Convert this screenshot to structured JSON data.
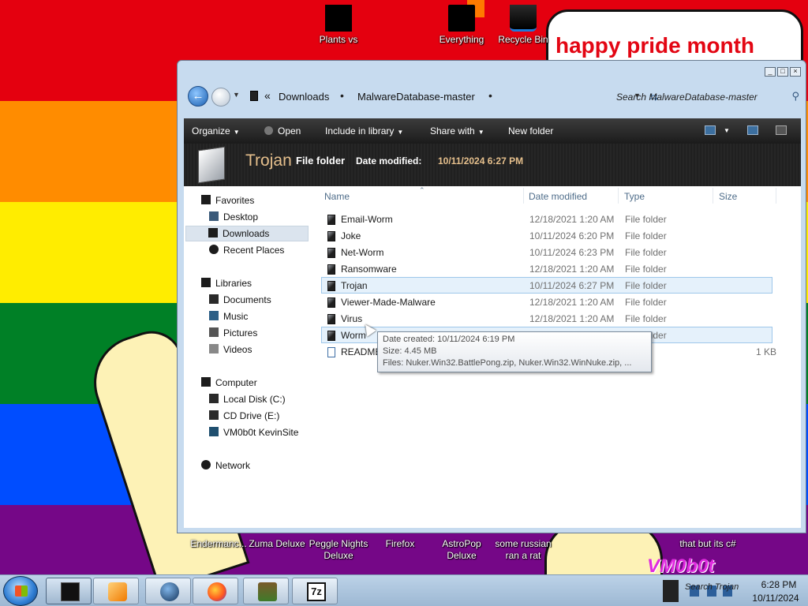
{
  "desktop": {
    "banner": "happy pride month",
    "icons_top": [
      {
        "label": "Plants vs",
        "icon": "plants-vs-zombies-icon"
      },
      {
        "label": "Everything",
        "icon": "everything-search-icon"
      },
      {
        "label": "Recycle Bin",
        "icon": "recycle-bin-icon"
      }
    ],
    "icons_bottom": [
      {
        "label": "Endermanc...",
        "icon": "app-icon"
      },
      {
        "label": "Zuma Deluxe",
        "icon": "game-icon"
      },
      {
        "label": "Peggle Nights Deluxe",
        "icon": "game-icon"
      },
      {
        "label": "Firefox",
        "icon": "firefox-icon"
      },
      {
        "label": "AstroPop Deluxe",
        "icon": "game-icon"
      },
      {
        "label": "some russian ran a rat",
        "icon": "file-icon"
      },
      {
        "label": "that but its c#",
        "icon": "file-icon"
      }
    ],
    "logo_text": "VM0b0t",
    "stripe_colors": [
      "#e4000f",
      "#ff8c00",
      "#ffed00",
      "#008026",
      "#004dff",
      "#750787"
    ]
  },
  "window": {
    "breadcrumb": [
      "Downloads",
      "MalwareDatabase-master"
    ],
    "breadcrumb_prefix": "«",
    "search_placeholder": "Search MalwareDatabase-master",
    "toolbar": {
      "organize": "Organize",
      "open": "Open",
      "include": "Include in library",
      "share": "Share with",
      "new_folder": "New folder"
    },
    "details": {
      "name": "Trojan",
      "type": "File folder",
      "modified_label": "Date modified:",
      "modified_value": "10/11/2024 6:27 PM"
    },
    "nav": {
      "favorites": "Favorites",
      "desktop": "Desktop",
      "downloads": "Downloads",
      "recent": "Recent Places",
      "libraries": "Libraries",
      "documents": "Documents",
      "music": "Music",
      "pictures": "Pictures",
      "videos": "Videos",
      "computer": "Computer",
      "local_disk": "Local Disk (C:)",
      "cd_drive": "CD Drive (E:)",
      "vm": "VM0b0t KevinSite",
      "network": "Network"
    },
    "columns": {
      "name": "Name",
      "date": "Date modified",
      "type": "Type",
      "size": "Size"
    },
    "rows": [
      {
        "name": "Email-Worm",
        "date": "12/18/2021 1:20 AM",
        "type": "File folder",
        "size": ""
      },
      {
        "name": "Joke",
        "date": "10/11/2024 6:20 PM",
        "type": "File folder",
        "size": ""
      },
      {
        "name": "Net-Worm",
        "date": "10/11/2024 6:23 PM",
        "type": "File folder",
        "size": ""
      },
      {
        "name": "Ransomware",
        "date": "12/18/2021 1:20 AM",
        "type": "File folder",
        "size": ""
      },
      {
        "name": "Trojan",
        "date": "10/11/2024 6:27 PM",
        "type": "File folder",
        "size": ""
      },
      {
        "name": "Viewer-Made-Malware",
        "date": "12/18/2021 1:20 AM",
        "type": "File folder",
        "size": ""
      },
      {
        "name": "Virus",
        "date": "12/18/2021 1:20 AM",
        "type": "File folder",
        "size": ""
      },
      {
        "name": "Worm",
        "date": "",
        "type": "File folder",
        "size": ""
      },
      {
        "name": "README",
        "date": "",
        "type": "",
        "size": "1 KB"
      }
    ],
    "tooltip": {
      "created": "Date created: 10/11/2024 6:19 PM",
      "size": "Size: 4.45 MB",
      "files": "Files: Nuker.Win32.BattlePong.zip, Nuker.Win32.WinNuke.zip, ..."
    }
  },
  "taskbar": {
    "apps": [
      "explorer-icon",
      "media-player-icon",
      "globe-icon",
      "firefox-icon",
      "game-icon",
      "7zip-icon"
    ],
    "sevenzip_label": "7z",
    "tray_tooltip": "Search Trojan",
    "time": "6:28 PM",
    "date": "10/11/2024"
  }
}
